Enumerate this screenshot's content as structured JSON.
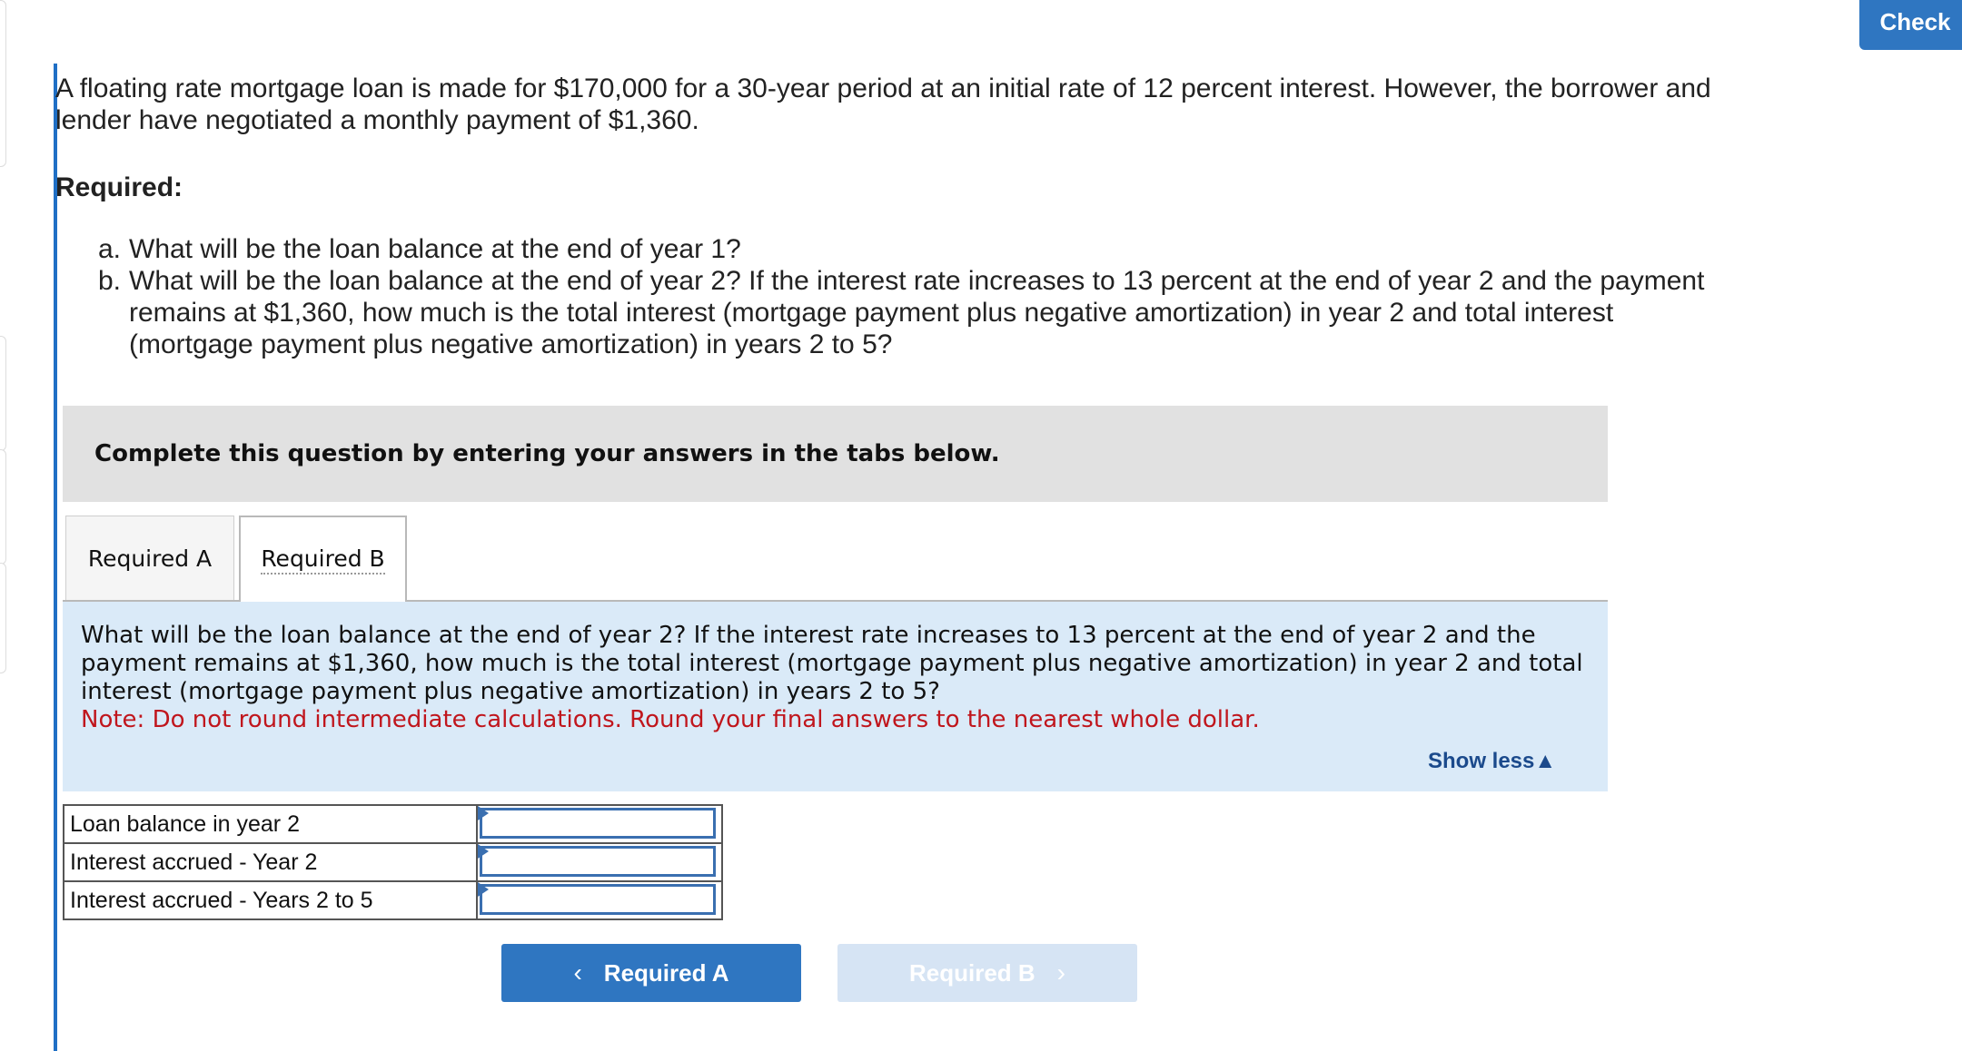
{
  "toolbar": {
    "check_label": "Check"
  },
  "problem": {
    "intro": "A floating rate mortgage loan is made for $170,000 for a 30-year period at an initial rate of 12 percent interest. However, the borrower and lender have negotiated a monthly payment of $1,360.",
    "required_title": "Required:",
    "items": [
      {
        "label": "a.",
        "text": "What will be the loan balance at the end of year 1?"
      },
      {
        "label": "b.",
        "text": "What will be the loan balance at the end of year 2? If the interest rate increases to 13 percent at the end of year 2 and the payment remains at $1,360, how much is the total interest (mortgage payment plus negative amortization) in year 2 and total interest (mortgage payment plus negative amortization) in years 2 to 5?"
      }
    ]
  },
  "instructions": "Complete this question by entering your answers in the tabs below.",
  "tabs": [
    {
      "label": "Required A",
      "active": false
    },
    {
      "label": "Required B",
      "active": true
    }
  ],
  "question": {
    "text": "What will be the loan balance at the end of year 2? If the interest rate increases to 13 percent at the end of year 2 and the payment remains at $1,360, how much is the total interest (mortgage payment plus negative amortization) in year 2 and total interest (mortgage payment plus negative amortization) in years 2 to 5?",
    "note": "Note: Do not round intermediate calculations. Round your final answers to the nearest whole dollar.",
    "show_less": "Show less",
    "show_less_icon": "▲"
  },
  "answers": [
    {
      "label": "Loan balance in year 2",
      "value": ""
    },
    {
      "label": "Interest accrued - Year 2",
      "value": ""
    },
    {
      "label": "Interest accrued - Years 2 to 5",
      "value": ""
    }
  ],
  "nav": {
    "prev_label": "Required A",
    "prev_icon": "‹",
    "next_label": "Required B",
    "next_icon": "›"
  },
  "colors": {
    "accent": "#2f76c1",
    "note": "#c0161d",
    "panel": "#daeaf8",
    "instruction_bg": "#e1e1e1"
  }
}
